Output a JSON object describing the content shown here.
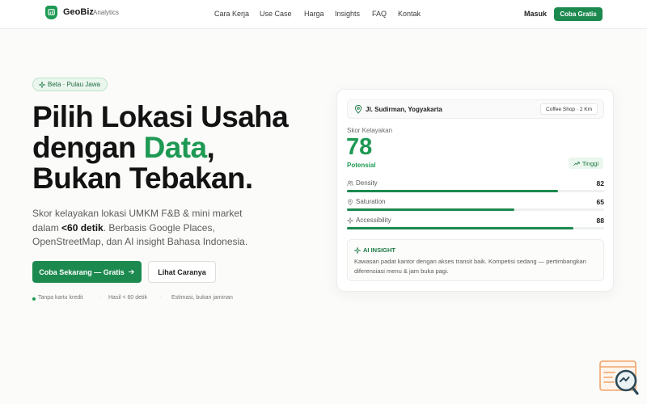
{
  "nav": {
    "brand": "GeoBiz",
    "brand_sub": "Analytics",
    "links": [
      "Cara Kerja",
      "Use Case",
      "Harga",
      "Insights",
      "FAQ",
      "Kontak"
    ],
    "login": "Masuk",
    "cta": "Coba Gratis"
  },
  "hero": {
    "badge": "Beta · Pulau Jawa",
    "title_line1": "Pilih Lokasi Usaha",
    "title_line2_pre": "dengan ",
    "title_line2_accent": "Data",
    "title_line2_post": ",",
    "title_line3": "Bukan Tebakan.",
    "desc_pre": "Skor kelayakan lokasi UMKM F&B & mini market dalam ",
    "desc_bold": "<60 detik",
    "desc_post": ". Berbasis Google Places, OpenStreetMap, dan AI insight Bahasa Indonesia.",
    "btn_primary": "Coba Sekarang — Gratis",
    "btn_secondary": "Lihat Caranya",
    "notes": [
      "Tanpa kartu kredit",
      "Hasil < 60 detik",
      "Estimasi, bukan jaminan"
    ]
  },
  "card": {
    "location": "Jl. Sudirman, Yogyakarta",
    "location_chip": "Coffee Shop · 2 Km",
    "score_label": "Skor Kelayakan",
    "score_value": "78",
    "score_tier_label": "Potensial",
    "tier_chip": "Tinggi",
    "metrics": [
      {
        "name": "Density",
        "value": "82",
        "fill": 0.82,
        "icon": "users-icon"
      },
      {
        "name": "Saturation",
        "value": "65",
        "fill": 0.65,
        "icon": "pin-icon"
      },
      {
        "name": "Accessibility",
        "value": "88",
        "fill": 0.88,
        "icon": "sparkle-icon"
      }
    ],
    "ai_title": "AI INSIGHT",
    "ai_text": "Kawasan padat kantor dengan akses transit baik. Kompetisi sedang — pertimbangkan diferensiasi menu & jam buka pagi."
  },
  "colors": {
    "brand": "#1e9954",
    "brand_dark": "#1c8a4f",
    "badge_bg": "#eaf6ee"
  }
}
